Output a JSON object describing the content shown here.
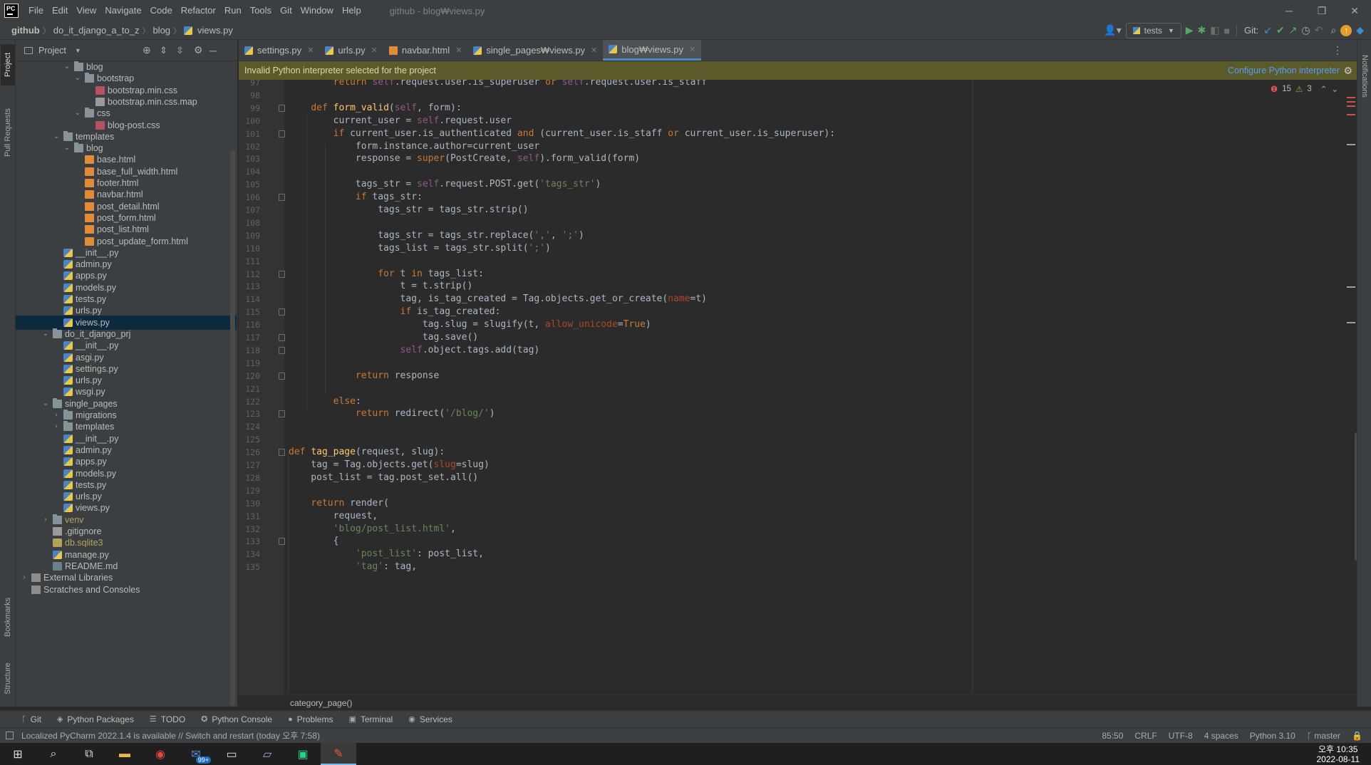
{
  "app": {
    "logo_text": "PC",
    "menu": [
      "File",
      "Edit",
      "View",
      "Navigate",
      "Code",
      "Refactor",
      "Run",
      "Tools",
      "Git",
      "Window",
      "Help"
    ],
    "window_title": "github - blog₩views.py"
  },
  "navbar": {
    "crumbs": [
      "github",
      "do_it_django_a_to_z",
      "blog",
      "views.py"
    ],
    "run_config": "tests",
    "git_label": "Git:"
  },
  "side_tabs": {
    "left": [
      "Project",
      "Pull Requests",
      "Bookmarks",
      "Structure"
    ],
    "right": [
      "Notifications"
    ]
  },
  "project": {
    "title": "Project",
    "tree": [
      {
        "name": "blog",
        "kind": "folder",
        "depth": 4,
        "expanded": true
      },
      {
        "name": "bootstrap",
        "kind": "folder",
        "depth": 5,
        "expanded": true
      },
      {
        "name": "bootstrap.min.css",
        "kind": "css",
        "depth": 6
      },
      {
        "name": "bootstrap.min.css.map",
        "kind": "txt",
        "depth": 6
      },
      {
        "name": "css",
        "kind": "folder",
        "depth": 5,
        "expanded": true
      },
      {
        "name": "blog-post.css",
        "kind": "css",
        "depth": 6
      },
      {
        "name": "templates",
        "kind": "folder",
        "depth": 3,
        "expanded": true
      },
      {
        "name": "blog",
        "kind": "folder",
        "depth": 4,
        "expanded": true
      },
      {
        "name": "base.html",
        "kind": "html",
        "depth": 5
      },
      {
        "name": "base_full_width.html",
        "kind": "html",
        "depth": 5
      },
      {
        "name": "footer.html",
        "kind": "html",
        "depth": 5
      },
      {
        "name": "navbar.html",
        "kind": "html",
        "depth": 5
      },
      {
        "name": "post_detail.html",
        "kind": "html",
        "depth": 5
      },
      {
        "name": "post_form.html",
        "kind": "html",
        "depth": 5
      },
      {
        "name": "post_list.html",
        "kind": "html",
        "depth": 5
      },
      {
        "name": "post_update_form.html",
        "kind": "html",
        "depth": 5
      },
      {
        "name": "__init__.py",
        "kind": "py",
        "depth": 3
      },
      {
        "name": "admin.py",
        "kind": "py",
        "depth": 3
      },
      {
        "name": "apps.py",
        "kind": "py",
        "depth": 3
      },
      {
        "name": "models.py",
        "kind": "py",
        "depth": 3
      },
      {
        "name": "tests.py",
        "kind": "py",
        "depth": 3
      },
      {
        "name": "urls.py",
        "kind": "py",
        "depth": 3
      },
      {
        "name": "views.py",
        "kind": "py",
        "depth": 3,
        "selected": true
      },
      {
        "name": "do_it_django_prj",
        "kind": "folder",
        "depth": 2,
        "expanded": true
      },
      {
        "name": "__init__.py",
        "kind": "py",
        "depth": 3
      },
      {
        "name": "asgi.py",
        "kind": "py",
        "depth": 3
      },
      {
        "name": "settings.py",
        "kind": "py",
        "depth": 3
      },
      {
        "name": "urls.py",
        "kind": "py",
        "depth": 3
      },
      {
        "name": "wsgi.py",
        "kind": "py",
        "depth": 3
      },
      {
        "name": "single_pages",
        "kind": "folder",
        "depth": 2,
        "expanded": true
      },
      {
        "name": "migrations",
        "kind": "folder",
        "depth": 3,
        "expanded": false
      },
      {
        "name": "templates",
        "kind": "folder",
        "depth": 3,
        "expanded": false
      },
      {
        "name": "__init__.py",
        "kind": "py",
        "depth": 3
      },
      {
        "name": "admin.py",
        "kind": "py",
        "depth": 3
      },
      {
        "name": "apps.py",
        "kind": "py",
        "depth": 3
      },
      {
        "name": "models.py",
        "kind": "py",
        "depth": 3
      },
      {
        "name": "tests.py",
        "kind": "py",
        "depth": 3
      },
      {
        "name": "urls.py",
        "kind": "py",
        "depth": 3
      },
      {
        "name": "views.py",
        "kind": "py",
        "depth": 3
      },
      {
        "name": "venv",
        "kind": "folder",
        "depth": 2,
        "expanded": false,
        "style": "venv"
      },
      {
        "name": ".gitignore",
        "kind": "txt",
        "depth": 2
      },
      {
        "name": "db.sqlite3",
        "kind": "db",
        "depth": 2,
        "style": "db"
      },
      {
        "name": "manage.py",
        "kind": "py",
        "depth": 2
      },
      {
        "name": "README.md",
        "kind": "md",
        "depth": 2
      },
      {
        "name": "External Libraries",
        "kind": "lib",
        "depth": 0,
        "expanded": false
      },
      {
        "name": "Scratches and Consoles",
        "kind": "lib",
        "depth": 0
      }
    ]
  },
  "tabs": [
    {
      "label": "settings.py",
      "kind": "py",
      "active": false
    },
    {
      "label": "urls.py",
      "kind": "py",
      "active": false
    },
    {
      "label": "navbar.html",
      "kind": "html",
      "active": false
    },
    {
      "label": "single_pages₩views.py",
      "kind": "py",
      "active": false
    },
    {
      "label": "blog₩views.py",
      "kind": "py",
      "active": true
    }
  ],
  "banner": {
    "message": "Invalid Python interpreter selected for the project",
    "action": "Configure Python interpreter"
  },
  "inspections": {
    "errors": "15",
    "warnings": "3"
  },
  "code": [
    {
      "n": "97",
      "fold": false,
      "s": [
        [
          "        ",
          ""
        ],
        [
          "return ",
          "kw"
        ],
        [
          "self",
          "sf"
        ],
        [
          ".request.user.is_superuser ",
          ""
        ],
        [
          "or ",
          "kw"
        ],
        [
          "self",
          "sf"
        ],
        [
          ".request.user.is_staff",
          ""
        ]
      ]
    },
    {
      "n": "98",
      "fold": false,
      "s": []
    },
    {
      "n": "99",
      "fold": true,
      "s": [
        [
          "    ",
          ""
        ],
        [
          "def ",
          "kw"
        ],
        [
          "form_valid",
          "fn"
        ],
        [
          "(",
          ""
        ],
        [
          "self",
          "sf"
        ],
        [
          ", form):",
          ""
        ]
      ]
    },
    {
      "n": "100",
      "fold": false,
      "s": [
        [
          "        current_user = ",
          ""
        ],
        [
          "self",
          "sf"
        ],
        [
          ".request.user",
          ""
        ]
      ]
    },
    {
      "n": "101",
      "fold": true,
      "s": [
        [
          "        ",
          ""
        ],
        [
          "if ",
          "kw"
        ],
        [
          "current_user.is_authenticated ",
          ""
        ],
        [
          "and ",
          "kw"
        ],
        [
          "(current_user.is_staff ",
          ""
        ],
        [
          "or ",
          "kw"
        ],
        [
          "current_user.is_superuser):",
          ""
        ]
      ]
    },
    {
      "n": "102",
      "fold": false,
      "s": [
        [
          "            form.instance.author=current_user",
          ""
        ]
      ]
    },
    {
      "n": "103",
      "fold": false,
      "s": [
        [
          "            response = ",
          ""
        ],
        [
          "super",
          "kw"
        ],
        [
          "(PostCreate, ",
          ""
        ],
        [
          "self",
          "sf"
        ],
        [
          ").form_valid(form)",
          ""
        ]
      ]
    },
    {
      "n": "104",
      "fold": false,
      "s": []
    },
    {
      "n": "105",
      "fold": false,
      "s": [
        [
          "            tags_str = ",
          ""
        ],
        [
          "self",
          "sf"
        ],
        [
          ".request.POST.get(",
          ""
        ],
        [
          "'tags_str'",
          "st"
        ],
        [
          ")",
          ""
        ]
      ]
    },
    {
      "n": "106",
      "fold": true,
      "s": [
        [
          "            ",
          ""
        ],
        [
          "if ",
          "kw"
        ],
        [
          "tags_str:",
          ""
        ]
      ]
    },
    {
      "n": "107",
      "fold": false,
      "s": [
        [
          "                tags_str = tags_str.strip()",
          ""
        ]
      ]
    },
    {
      "n": "108",
      "fold": false,
      "s": []
    },
    {
      "n": "109",
      "fold": false,
      "s": [
        [
          "                tags_str = tags_str.replace(",
          ""
        ],
        [
          "','",
          "st"
        ],
        [
          ", ",
          ""
        ],
        [
          "';'",
          "st"
        ],
        [
          ")",
          ""
        ]
      ]
    },
    {
      "n": "110",
      "fold": false,
      "s": [
        [
          "                tags_list = tags_str.split(",
          ""
        ],
        [
          "';'",
          "st"
        ],
        [
          ")",
          ""
        ]
      ]
    },
    {
      "n": "111",
      "fold": false,
      "s": []
    },
    {
      "n": "112",
      "fold": true,
      "s": [
        [
          "                ",
          ""
        ],
        [
          "for ",
          "kw"
        ],
        [
          "t ",
          ""
        ],
        [
          "in ",
          "kw"
        ],
        [
          "tags_list:",
          ""
        ]
      ]
    },
    {
      "n": "113",
      "fold": false,
      "s": [
        [
          "                    t = t.strip()",
          ""
        ]
      ]
    },
    {
      "n": "114",
      "fold": false,
      "s": [
        [
          "                    tag, is_tag_created = Tag.objects.get_or_create(",
          ""
        ],
        [
          "name",
          "pa"
        ],
        [
          "=t)",
          ""
        ]
      ]
    },
    {
      "n": "115",
      "fold": true,
      "s": [
        [
          "                    ",
          ""
        ],
        [
          "if ",
          "kw"
        ],
        [
          "is_tag_created:",
          ""
        ]
      ]
    },
    {
      "n": "116",
      "fold": false,
      "s": [
        [
          "                        tag.slug = slugify(t, ",
          ""
        ],
        [
          "allow_unicode",
          "pa"
        ],
        [
          "=",
          ""
        ],
        [
          "True",
          "kw"
        ],
        [
          ")",
          ""
        ]
      ]
    },
    {
      "n": "117",
      "fold": true,
      "s": [
        [
          "                        tag.save()",
          ""
        ]
      ]
    },
    {
      "n": "118",
      "fold": true,
      "s": [
        [
          "                    ",
          ""
        ],
        [
          "self",
          "sf"
        ],
        [
          ".object.tags.add(tag)",
          ""
        ]
      ]
    },
    {
      "n": "119",
      "fold": false,
      "s": []
    },
    {
      "n": "120",
      "fold": true,
      "s": [
        [
          "            ",
          ""
        ],
        [
          "return ",
          "kw"
        ],
        [
          "response",
          ""
        ]
      ]
    },
    {
      "n": "121",
      "fold": false,
      "s": []
    },
    {
      "n": "122",
      "fold": false,
      "s": [
        [
          "        ",
          ""
        ],
        [
          "else",
          "kw"
        ],
        [
          ":",
          ""
        ]
      ]
    },
    {
      "n": "123",
      "fold": true,
      "s": [
        [
          "            ",
          ""
        ],
        [
          "return ",
          "kw"
        ],
        [
          "redirect(",
          ""
        ],
        [
          "'/blog/'",
          "st"
        ],
        [
          ")",
          ""
        ]
      ]
    },
    {
      "n": "124",
      "fold": false,
      "s": []
    },
    {
      "n": "125",
      "fold": false,
      "s": []
    },
    {
      "n": "126",
      "fold": true,
      "s": [
        [
          "",
          ""
        ],
        [
          "def ",
          "kw"
        ],
        [
          "tag_page",
          "fn"
        ],
        [
          "(request, slug):",
          ""
        ]
      ]
    },
    {
      "n": "127",
      "fold": false,
      "s": [
        [
          "    tag = Tag.objects.get(",
          ""
        ],
        [
          "slug",
          "pa"
        ],
        [
          "=slug)",
          ""
        ]
      ]
    },
    {
      "n": "128",
      "fold": false,
      "s": [
        [
          "    post_list = tag.post_set.all()",
          ""
        ]
      ]
    },
    {
      "n": "129",
      "fold": false,
      "s": []
    },
    {
      "n": "130",
      "fold": false,
      "s": [
        [
          "    ",
          ""
        ],
        [
          "return ",
          "kw"
        ],
        [
          "render(",
          ""
        ]
      ]
    },
    {
      "n": "131",
      "fold": false,
      "s": [
        [
          "        request,",
          ""
        ]
      ]
    },
    {
      "n": "132",
      "fold": false,
      "s": [
        [
          "        ",
          ""
        ],
        [
          "'blog/post_list.html'",
          "st"
        ],
        [
          ",",
          ""
        ]
      ]
    },
    {
      "n": "133",
      "fold": true,
      "s": [
        [
          "        {",
          ""
        ]
      ]
    },
    {
      "n": "134",
      "fold": false,
      "s": [
        [
          "            ",
          ""
        ],
        [
          "'post_list'",
          "st"
        ],
        [
          ": post_list,",
          ""
        ]
      ]
    },
    {
      "n": "135",
      "fold": false,
      "s": [
        [
          "            ",
          ""
        ],
        [
          "'tag'",
          "st"
        ],
        [
          ": tag,",
          ""
        ]
      ]
    }
  ],
  "editor_breadcrumb": "category_page()",
  "bottom_tools": [
    {
      "icon": "git-icon",
      "label": "Git",
      "glyph": "ᚴ"
    },
    {
      "icon": "python-packages-icon",
      "label": "Python Packages",
      "glyph": "◈"
    },
    {
      "icon": "todo-icon",
      "label": "TODO",
      "glyph": "☰"
    },
    {
      "icon": "python-console-icon",
      "label": "Python Console",
      "glyph": "✪"
    },
    {
      "icon": "problems-icon",
      "label": "Problems",
      "glyph": "●"
    },
    {
      "icon": "terminal-icon",
      "label": "Terminal",
      "glyph": "▣"
    },
    {
      "icon": "services-icon",
      "label": "Services",
      "glyph": "◉"
    }
  ],
  "status": {
    "message": "Localized PyCharm 2022.1.4 is available // Switch and restart (today 오후 7:58)",
    "position": "85:50",
    "line_sep": "CRLF",
    "encoding": "UTF-8",
    "indent": "4 spaces",
    "interpreter": "Python 3.10",
    "branch": "master"
  },
  "taskbar": {
    "mail_badge": "99+",
    "time": "오후 10:35",
    "date": "2022-08-11"
  },
  "colors": {
    "keyword": "#cc7832",
    "function": "#ffc66d",
    "string": "#6a8759",
    "self": "#94558d",
    "param": "#aa4926",
    "accent": "#4a88c7"
  }
}
